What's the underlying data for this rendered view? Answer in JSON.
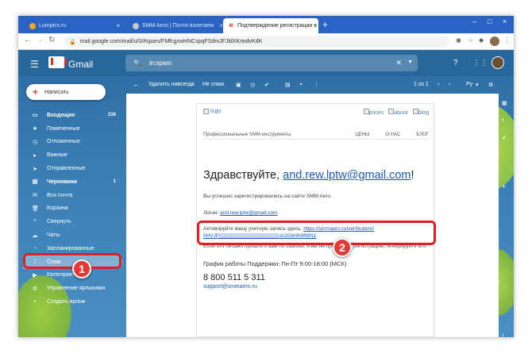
{
  "browser": {
    "tabs": [
      {
        "label": "Lumpics.ru",
        "close": "×"
      },
      {
        "label": "SMM Aero | Почти взлетаем",
        "close": "×"
      },
      {
        "label": "Подтверждение регистрации в",
        "close": "×"
      }
    ],
    "new_tab": "+",
    "window_controls": [
      "–",
      "□",
      "×"
    ],
    "url": "mail.google.com/mail/u/0/#spam/FMfcgxwHNCspqFSdmJFJldXKrwdvKdK"
  },
  "gmail": {
    "product": "Gmail",
    "search_value": "in:spam",
    "compose_label": "Написать",
    "nav": [
      {
        "icon": "inbox-icon",
        "glyph": "▭",
        "label": "Входящие",
        "count": "216",
        "bold": true
      },
      {
        "icon": "star-icon",
        "glyph": "★",
        "label": "Помеченные",
        "count": ""
      },
      {
        "icon": "clock-icon",
        "glyph": "◷",
        "label": "Отложенные",
        "count": ""
      },
      {
        "icon": "important-icon",
        "glyph": "▸",
        "label": "Важные",
        "count": ""
      },
      {
        "icon": "send-icon",
        "glyph": "➤",
        "label": "Отправленные",
        "count": ""
      },
      {
        "icon": "draft-icon",
        "glyph": "▤",
        "label": "Черновики",
        "count": "1",
        "bold": true
      },
      {
        "icon": "allmail-icon",
        "glyph": "✉",
        "label": "Вся почта",
        "count": ""
      },
      {
        "icon": "trash-icon",
        "glyph": "🗑",
        "label": "Корзина",
        "count": ""
      },
      {
        "icon": "collapse-icon",
        "glyph": "^",
        "label": "Свернуть",
        "count": ""
      },
      {
        "icon": "chat-icon",
        "glyph": "☁",
        "label": "Чаты",
        "count": ""
      },
      {
        "icon": "scheduled-icon",
        "glyph": "◔",
        "label": "Запланированные",
        "count": ""
      },
      {
        "icon": "spam-icon",
        "glyph": "!",
        "label": "Спам",
        "count": "",
        "selected": true
      },
      {
        "icon": "categories-icon",
        "glyph": "▶",
        "label": "Категории",
        "count": ""
      },
      {
        "icon": "gear-icon",
        "glyph": "⚙",
        "label": "Управление ярлыками",
        "count": ""
      },
      {
        "icon": "plus-icon",
        "glyph": "+",
        "label": "Создать ярлык",
        "count": ""
      }
    ],
    "toolbar": {
      "back": "←",
      "delete_forever": "Удалить навсегда",
      "not_spam": "Не спам",
      "pagination": "1 из 1",
      "lang": "Ру"
    }
  },
  "email": {
    "logo_alt": "logo",
    "links": [
      "prices",
      "about",
      "blog"
    ],
    "tagline": "Профессиональные SMM-инструменты",
    "menu": [
      "ЦЕНЫ",
      "О НАС",
      "БЛОГ"
    ],
    "greeting_prefix": "Здравствуйте, ",
    "greeting_email": "and.rew.lptw@gmail.com",
    "greeting_suffix": "!",
    "registered": "Вы успешно зарегистрировались на сайте SMM Aero.",
    "login_label": "Логин: ",
    "login_value": "and.rew.lptw@gmail.com",
    "activate_text": "Активируйте вашу учетную запись здесь: ",
    "activate_link_a": "https://smmaero.ru/verification/",
    "activate_link_b_start": "0HVJP",
    "activate_link_b_end": "Uc2GbHh9fWN1",
    "ignore_text_a": "Если это письмо пришло к вам по ошибке, и вы не",
    "ignore_text_b": "проходили регистрацию, игнорируйте его.",
    "support_title": "График работы Поддержки: Пн-Пт 9:00-18:00 (МСК)",
    "phone": "8 800 511 5 311",
    "support_email": "support@smmaero.ru"
  },
  "annotations": {
    "badge1": "1",
    "badge2": "2",
    "highlight_color": "#e02020"
  }
}
